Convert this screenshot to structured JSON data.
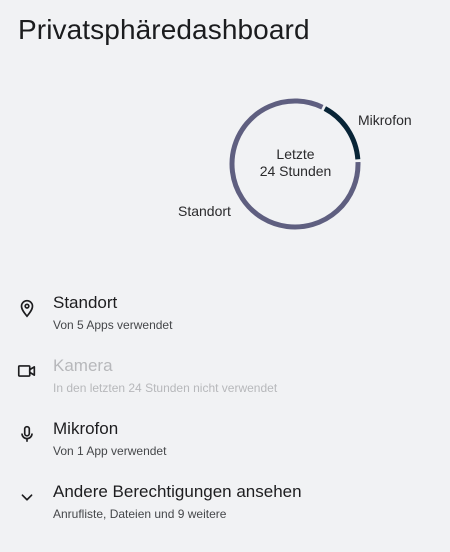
{
  "header": {
    "title": "Privatsphäredashboard"
  },
  "chart": {
    "center_line1": "Letzte",
    "center_line2": "24 Stunden",
    "segments": [
      {
        "label": "Standort",
        "color": "#5f5f80"
      },
      {
        "label": "Mikrofon",
        "color": "#082436"
      }
    ]
  },
  "chart_data": {
    "type": "pie",
    "categories": [
      "Standort",
      "Mikrofon"
    ],
    "values": [
      5,
      1
    ],
    "title": ""
  },
  "permissions": [
    {
      "title": "Standort",
      "subtitle": "Von 5 Apps verwendet",
      "icon": "location-pin-icon",
      "enabled": true
    },
    {
      "title": "Kamera",
      "subtitle": "In den letzten 24 Stunden nicht verwendet",
      "icon": "camera-icon",
      "enabled": false
    },
    {
      "title": "Mikrofon",
      "subtitle": "Von 1 App verwendet",
      "icon": "microphone-icon",
      "enabled": true
    },
    {
      "title": "Andere Berechtigungen ansehen",
      "subtitle": "Anrufliste, Dateien und 9 weitere",
      "icon": "chevron-down-icon",
      "enabled": true
    }
  ]
}
